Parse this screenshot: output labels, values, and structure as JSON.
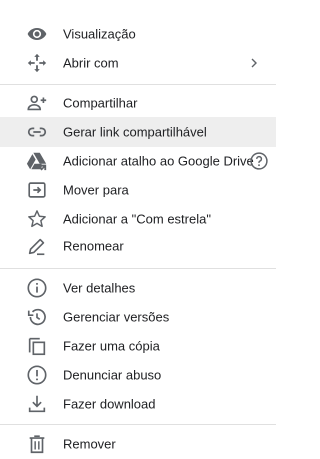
{
  "menu": {
    "items": [
      {
        "label": "Visualização",
        "icon": "eye-icon"
      },
      {
        "label": "Abrir com",
        "icon": "move-arrows-icon",
        "submenu": "chevron-right-icon"
      },
      {
        "label": "Compartilhar",
        "icon": "add-person-icon"
      },
      {
        "label": "Gerar link compartilhável",
        "icon": "link-icon",
        "highlighted": true
      },
      {
        "label": "Adicionar atalho ao Google Drive",
        "icon": "drive-shortcut-icon",
        "help": "help-circle-icon"
      },
      {
        "label": "Mover para",
        "icon": "move-to-folder-icon"
      },
      {
        "label": "Adicionar a \"Com estrela\"",
        "icon": "star-outline-icon"
      },
      {
        "label": "Renomear",
        "icon": "pencil-icon"
      },
      {
        "label": "Ver detalhes",
        "icon": "info-icon"
      },
      {
        "label": "Gerenciar versões",
        "icon": "history-icon"
      },
      {
        "label": "Fazer uma cópia",
        "icon": "copy-icon"
      },
      {
        "label": "Denunciar abuso",
        "icon": "report-icon"
      },
      {
        "label": "Fazer download",
        "icon": "download-icon"
      },
      {
        "label": "Remover",
        "icon": "trash-icon"
      }
    ]
  },
  "colors": {
    "text": "#202124",
    "icon": "#5f6368",
    "highlight": "#eeeeee",
    "divider": "#e0e0e0"
  }
}
